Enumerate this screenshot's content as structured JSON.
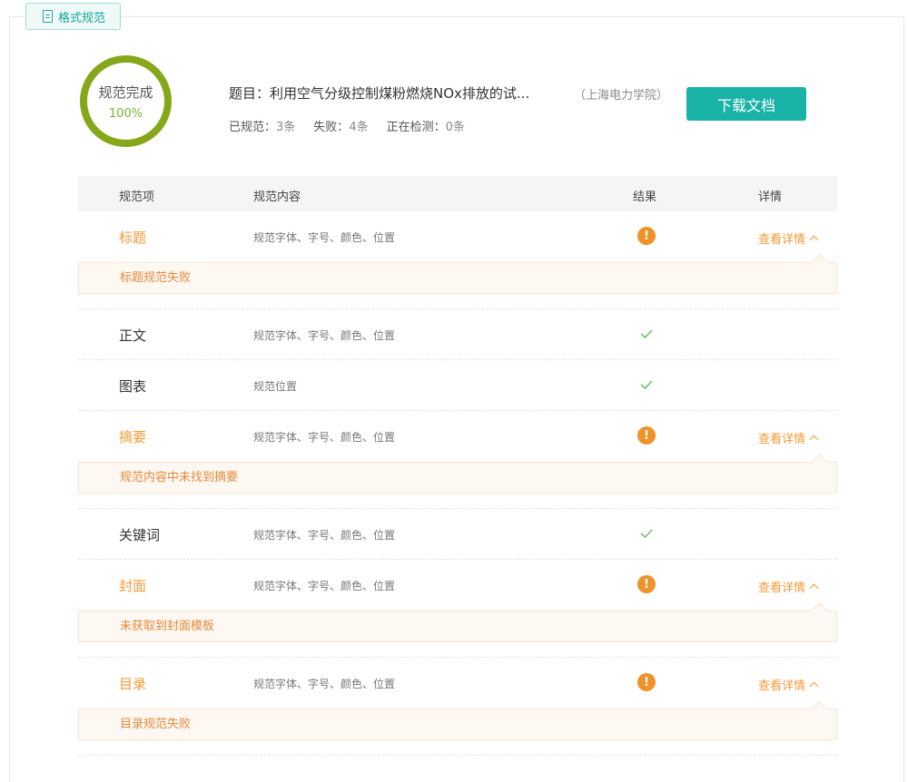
{
  "tab": {
    "label": "格式规范"
  },
  "summary": {
    "ring_label": "规范完成",
    "ring_percent": "100%",
    "ring_progress": 100,
    "ring_color": "#86a71a",
    "title": "题目：利用空气分级控制煤粉燃烧NOx排放的试...",
    "school": "（上海电力学院）",
    "stats": [
      {
        "label": "已规范：",
        "value": "3条"
      },
      {
        "label": "失败：",
        "value": "4条"
      },
      {
        "label": "正在检测：",
        "value": "0条"
      }
    ],
    "download_label": "下载文档",
    "accent_color": "#19b2a6"
  },
  "table": {
    "headers": {
      "item": "规范项",
      "content": "规范内容",
      "result": "结果",
      "detail": "详情"
    },
    "rows": [
      {
        "name": "标题",
        "content": "规范字体、字号、颜色、位置",
        "status": "fail",
        "detail": "查看详情",
        "message": "标题规范失败"
      },
      {
        "name": "正文",
        "content": "规范字体、字号、颜色、位置",
        "status": "pass"
      },
      {
        "name": "图表",
        "content": "规范位置",
        "status": "pass"
      },
      {
        "name": "摘要",
        "content": "规范字体、字号、颜色、位置",
        "status": "fail",
        "detail": "查看详情",
        "message": "规范内容中未找到摘要"
      },
      {
        "name": "关键词",
        "content": "规范字体、字号、颜色、位置",
        "status": "pass"
      },
      {
        "name": "封面",
        "content": "规范字体、字号、颜色、位置",
        "status": "fail",
        "detail": "查看详情",
        "message": "未获取到封面模板"
      },
      {
        "name": "目录",
        "content": "规范字体、字号、颜色、位置",
        "status": "fail",
        "detail": "查看详情",
        "message": "目录规范失败"
      }
    ],
    "fail_color": "#f0922a",
    "pass_color": "#6cc26c"
  }
}
